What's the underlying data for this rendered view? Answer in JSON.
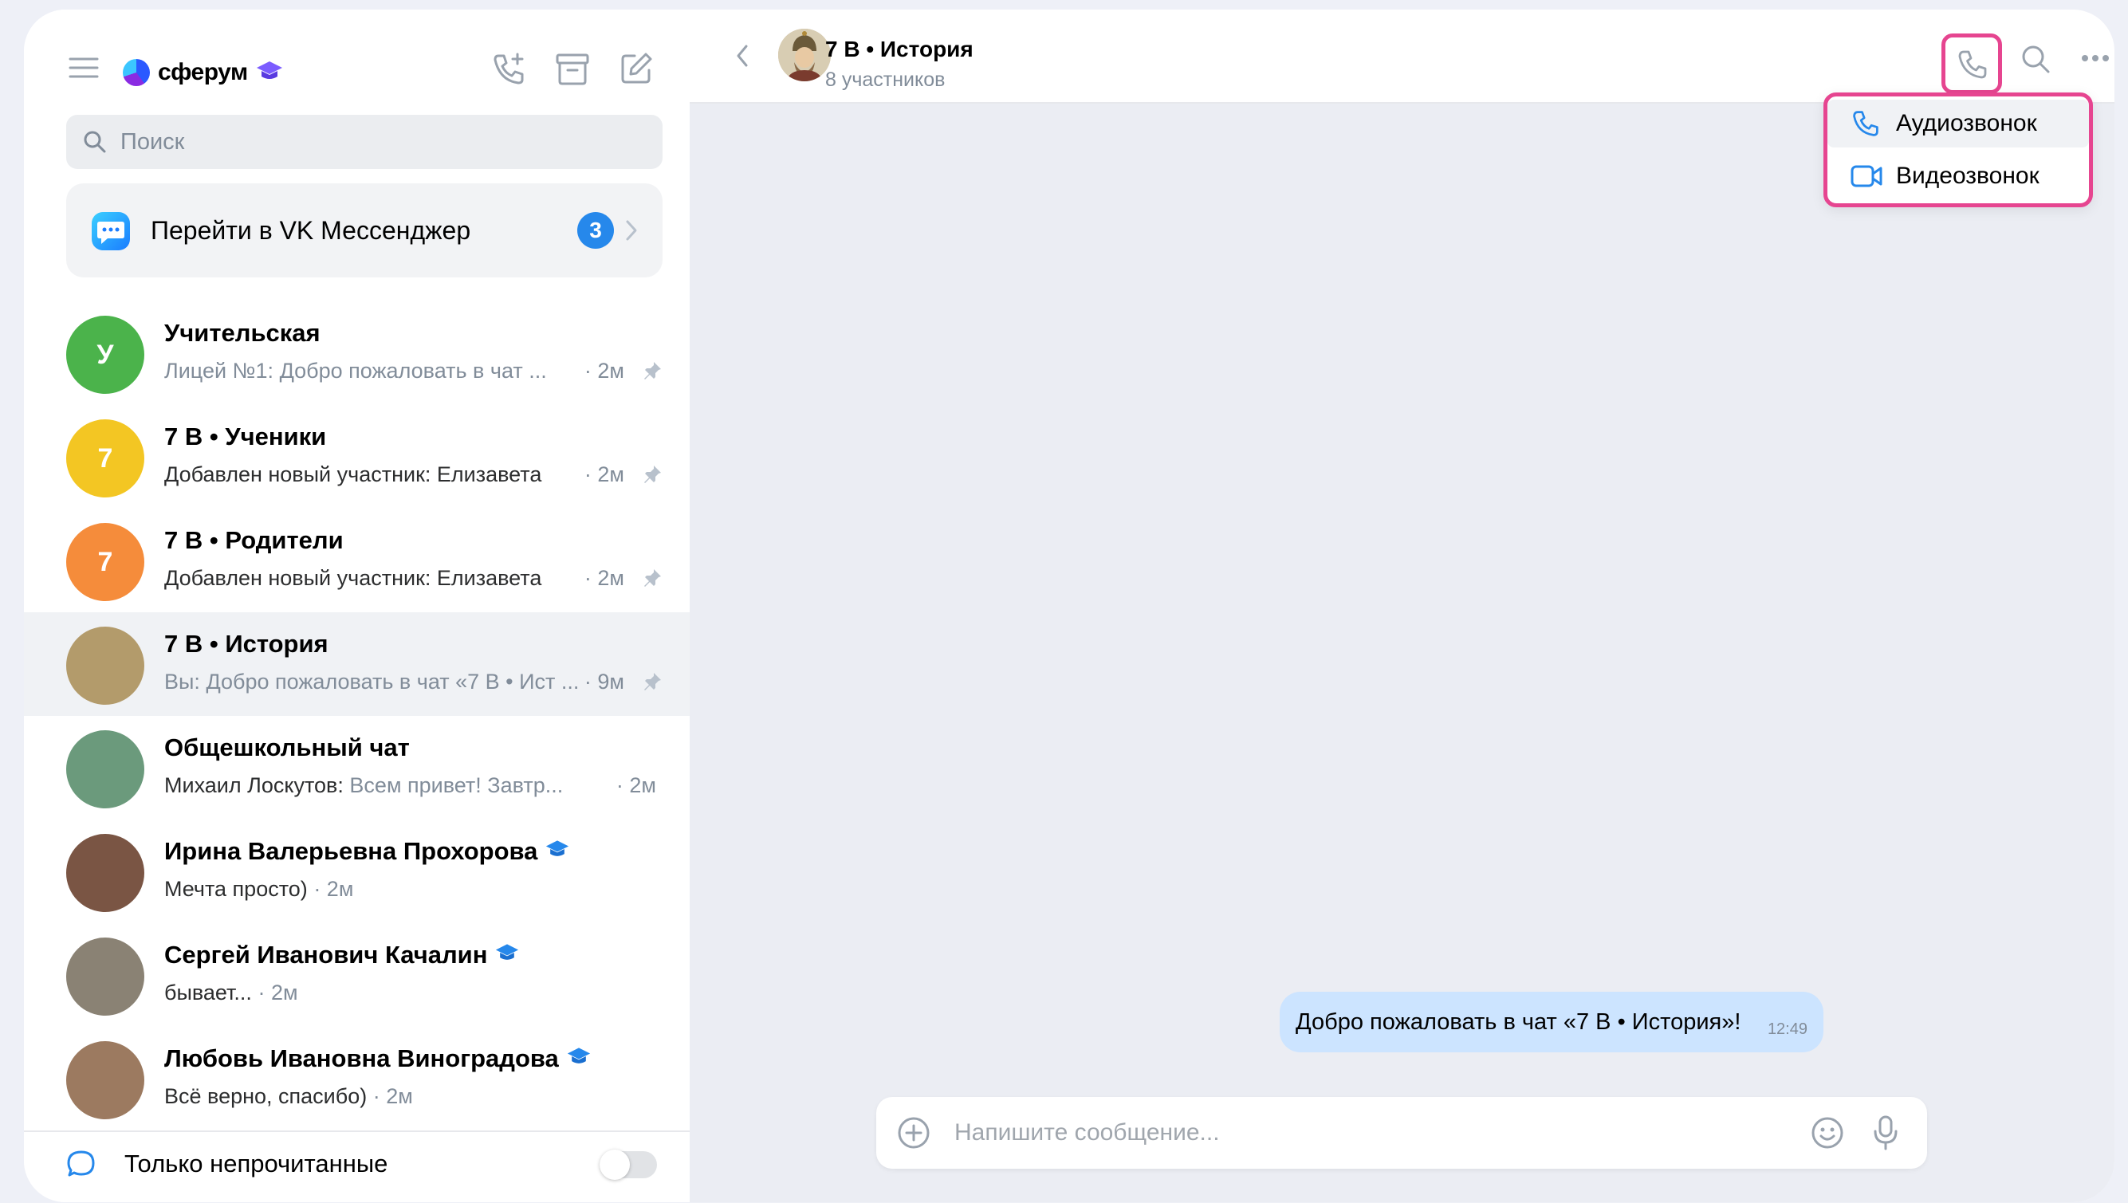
{
  "app": {
    "name": "сферум"
  },
  "sidebar": {
    "search_placeholder": "Поиск",
    "vk_banner": {
      "label": "Перейти в VK Мессенджер",
      "badge": "3"
    },
    "chats": [
      {
        "avatar_letter": "У",
        "avatar_color": "#4bb34b",
        "title": "Учительская",
        "sender": "Лицей №1:",
        "preview": "Добро пожаловать в чат ...",
        "time": "· 2м",
        "pinned": true,
        "verified": false
      },
      {
        "avatar_letter": "7",
        "avatar_color": "#f3c623",
        "title": "7 В • Ученики",
        "sender": "",
        "preview": "Добавлен новый участник: Елизавета",
        "time": "· 2м",
        "pinned": true,
        "verified": false
      },
      {
        "avatar_letter": "7",
        "avatar_color": "#f58c3b",
        "title": "7 В • Родители",
        "sender": "",
        "preview": "Добавлен новый участник: Елизавета",
        "time": "· 2м",
        "pinned": true,
        "verified": false
      },
      {
        "avatar_letter": "",
        "avatar_color": "#b39b6b",
        "title": "7 В • История",
        "sender": "Вы:",
        "preview": "Добро пожаловать в чат «7 В • Ист ...",
        "time": "· 9м",
        "pinned": true,
        "verified": false,
        "active": true
      },
      {
        "avatar_letter": "",
        "avatar_color": "#6b9a7c",
        "title": "Общешкольный чат",
        "sender": "Михаил Лоскутов:",
        "preview": "Всем привет! Завтр...",
        "time": "· 2м",
        "pinned": false,
        "verified": false
      },
      {
        "avatar_letter": "",
        "avatar_color": "#7a5544",
        "title": "Ирина Валерьевна Прохорова",
        "sender": "",
        "preview": "Мечта просто)",
        "time": "· 2м",
        "pinned": false,
        "verified": true,
        "inline_time": true
      },
      {
        "avatar_letter": "",
        "avatar_color": "#8a8274",
        "title": "Сергей Иванович Качалин",
        "sender": "",
        "preview": "бывает...",
        "time": "· 2м",
        "pinned": false,
        "verified": true,
        "inline_time": true
      },
      {
        "avatar_letter": "",
        "avatar_color": "#9c7a60",
        "title": "Любовь Ивановна Виноградова",
        "sender": "",
        "preview": "Всё верно, спасибо)",
        "time": "· 2м",
        "pinned": false,
        "verified": true,
        "inline_time": true
      }
    ],
    "footer": {
      "label": "Только непрочитанные",
      "toggle_on": false
    }
  },
  "header": {
    "title": "7 В • История",
    "subtitle": "8 участников"
  },
  "call_menu": {
    "audio": "Аудиозвонок",
    "video": "Видеозвонок"
  },
  "message": {
    "text": "Добро пожаловать в чат «7 В • История»!",
    "time": "12:49"
  },
  "composer": {
    "placeholder": "Напишите сообщение..."
  },
  "colors": {
    "accent": "#2688eb",
    "highlight": "#e64590",
    "bubble": "#cce4ff"
  }
}
